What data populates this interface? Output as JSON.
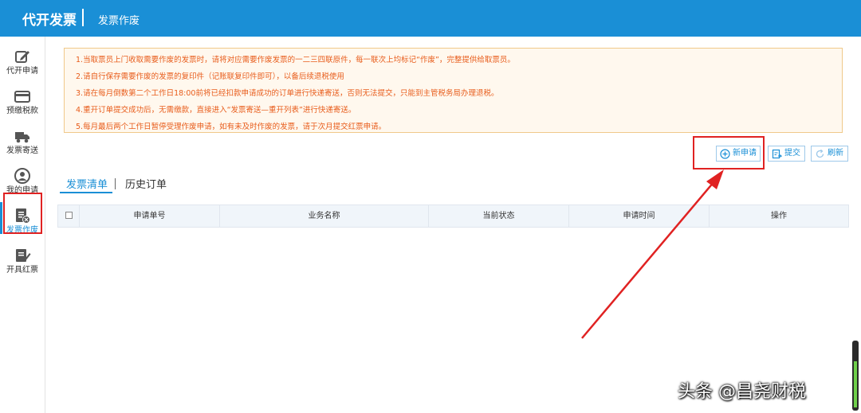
{
  "header": {
    "title": "代开发票",
    "subtitle": "发票作废"
  },
  "sidebar": {
    "items": [
      {
        "label": "代开申请"
      },
      {
        "label": "预缴税款"
      },
      {
        "label": "发票寄送"
      },
      {
        "label": "我的申请"
      },
      {
        "label": "发票作废"
      },
      {
        "label": "开具红票"
      }
    ]
  },
  "notice": {
    "lines": [
      "1.当取票员上门收取需要作废的发票时，请将对应需要作废发票的一二三四联原件，每一联次上均标记“作废”，完整提供给取票员。",
      "2.请自行保存需要作废的发票的复印件（记账联复印件即可），以备后续退税使用",
      "3.请在每月倒数第二个工作日18:00前将已经扣款申请成功的订单进行快递寄送，否则无法提交，只能到主管税务局办理退税。",
      "4.重开订单提交成功后，无需缴款，直接进入“发票寄送—重开列表”进行快递寄送。",
      "5.每月最后两个工作日暂停受理作废申请，如有未及时作废的发票，请于次月提交红票申请。"
    ]
  },
  "toolbar": {
    "new_label": "新申请",
    "submit_label": "提交",
    "refresh_label": "刷新"
  },
  "tabs": [
    {
      "label": "发票清单"
    },
    {
      "label": "历史订单"
    }
  ],
  "table": {
    "headers": [
      "申请单号",
      "业务名称",
      "当前状态",
      "申请时间",
      "操作"
    ]
  },
  "watermark": {
    "text": "头条 @昌尧财税"
  },
  "level_indicator": {
    "value": 0.72
  },
  "colors": {
    "brand": "#1a8fd6",
    "notice_text": "#e85d1c",
    "highlight": "#e02222"
  }
}
